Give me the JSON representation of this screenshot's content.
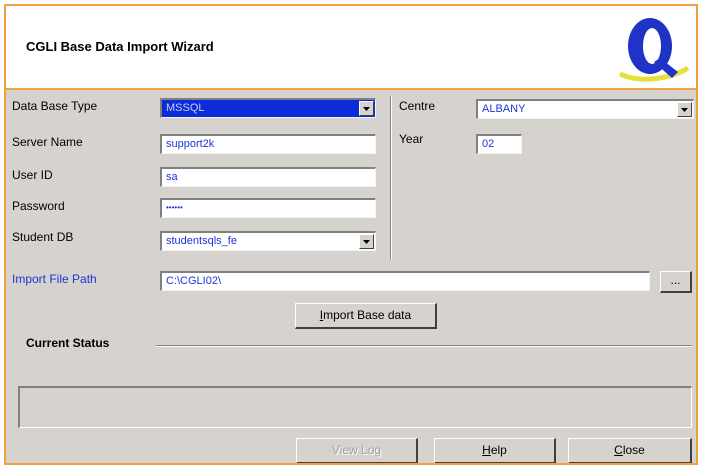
{
  "window": {
    "title": "CGLI Base Data Import Wizard",
    "logo_letter": "Q"
  },
  "left_form": {
    "db_type": {
      "label": "Data Base Type",
      "value": "MSSQL"
    },
    "server": {
      "label": "Server Name",
      "value": "support2k"
    },
    "user": {
      "label": "User ID",
      "value": "sa"
    },
    "password": {
      "label": "Password",
      "value": "••••••"
    },
    "student_db": {
      "label": "Student DB",
      "value": "studentsqls_fe"
    }
  },
  "right_form": {
    "centre": {
      "label": "Centre",
      "value": "ALBANY"
    },
    "year": {
      "label": "Year",
      "value": "02"
    }
  },
  "import": {
    "label": "Import File Path",
    "value": "C:\\CGLI02\\",
    "browse_label": "...",
    "import_button": {
      "mnemonic": "I",
      "rest": "mport Base data"
    }
  },
  "status": {
    "title": "Current Status",
    "text": ""
  },
  "footer": {
    "view_log": "View Log",
    "help": {
      "mnemonic": "H",
      "rest": "elp"
    },
    "close": {
      "mnemonic": "C",
      "rest": "lose"
    }
  },
  "colors": {
    "accent": "#f0a040",
    "field_text": "#1a35d8",
    "selection": "#0b2cd8",
    "dialog_bg": "#d6d3ce"
  }
}
